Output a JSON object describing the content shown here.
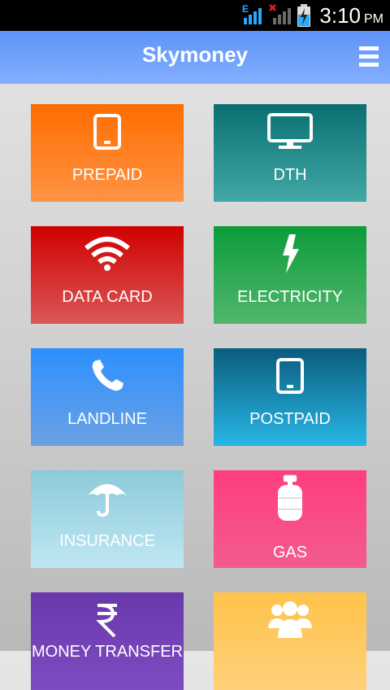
{
  "status_bar": {
    "network_letter": "E",
    "time": "3:10",
    "ampm": "PM"
  },
  "header": {
    "title": "Skymoney"
  },
  "tiles": [
    {
      "label": "PREPAID",
      "icon": "tablet-icon",
      "color": "#ff7a1a"
    },
    {
      "label": "DTH",
      "icon": "monitor-icon",
      "color": "#1f8a8a"
    },
    {
      "label": "DATA CARD",
      "icon": "wifi-icon",
      "color": "#d42a2a"
    },
    {
      "label": "ELECTRICITY",
      "icon": "lightning-icon",
      "color": "#28a752"
    },
    {
      "label": "LANDLINE",
      "icon": "phone-icon",
      "color": "#3f98f5"
    },
    {
      "label": "POSTPAID",
      "icon": "tablet-icon",
      "color": "#1689b5"
    },
    {
      "label": "INSURANCE",
      "icon": "umbrella-icon",
      "color": "#a3d8e6"
    },
    {
      "label": "GAS",
      "icon": "gas-cylinder-icon",
      "color": "#f94b83"
    },
    {
      "label": "MONEY TRANSFER",
      "icon": "rupee-icon",
      "color": "#7140b4"
    },
    {
      "label": "",
      "icon": "group-icon",
      "color": "#ffc760"
    }
  ]
}
